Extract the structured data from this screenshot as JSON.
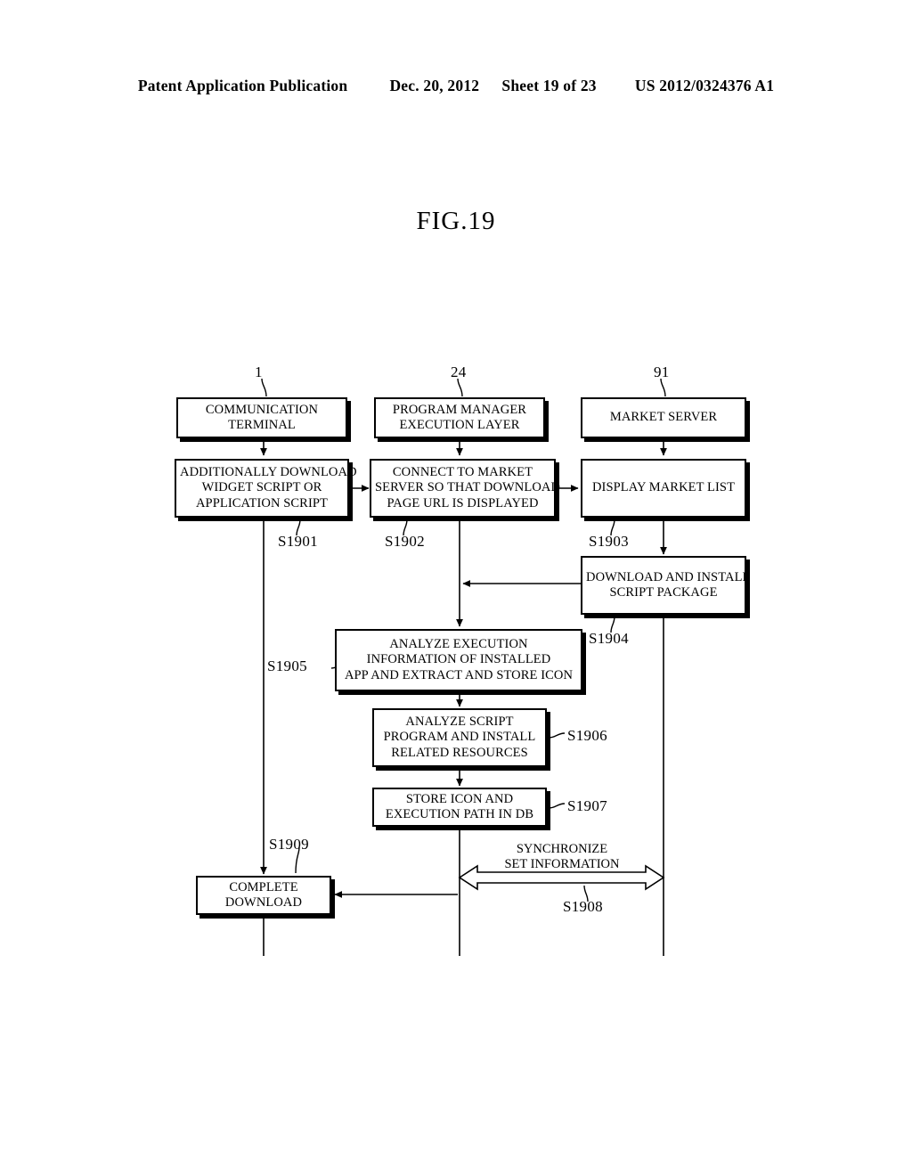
{
  "header": {
    "publication": "Patent Application Publication",
    "date": "Dec. 20, 2012",
    "sheet": "Sheet 19 of 23",
    "patent_number": "US 2012/0324376 A1"
  },
  "figure": {
    "title": "FIG.19"
  },
  "diagram": {
    "type": "sequence-flowchart",
    "lanes": [
      {
        "id": "terminal",
        "ref": "1",
        "title_line1": "COMMUNICATION",
        "title_line2": "TERMINAL"
      },
      {
        "id": "pmlayer",
        "ref": "24",
        "title_line1": "PROGRAM MANAGER",
        "title_line2": "EXECUTION LAYER"
      },
      {
        "id": "market",
        "ref": "91",
        "title_line1": "MARKET SERVER",
        "title_line2": ""
      }
    ],
    "nodes": [
      {
        "id": "lane-terminal",
        "lines": [
          "COMMUNICATION",
          "TERMINAL"
        ]
      },
      {
        "id": "lane-pmlayer",
        "lines": [
          "PROGRAM MANAGER",
          "EXECUTION LAYER"
        ]
      },
      {
        "id": "lane-market",
        "lines": [
          "MARKET SERVER"
        ]
      },
      {
        "id": "s1901-box",
        "lines": [
          "ADDITIONALLY DOWNLOAD",
          "WIDGET SCRIPT OR",
          "APPLICATION SCRIPT"
        ]
      },
      {
        "id": "s1902-box",
        "lines": [
          "CONNECT TO MARKET",
          "SERVER SO THAT DOWNLOAD",
          "PAGE URL IS DISPLAYED"
        ]
      },
      {
        "id": "s1903-box",
        "lines": [
          "DISPLAY MARKET LIST"
        ]
      },
      {
        "id": "s1904-box",
        "lines": [
          "DOWNLOAD AND INSTALL",
          "SCRIPT PACKAGE"
        ]
      },
      {
        "id": "s1905-box",
        "lines": [
          "ANALYZE EXECUTION",
          "INFORMATION OF INSTALLED",
          "APP AND EXTRACT AND STORE ICON"
        ]
      },
      {
        "id": "s1906-box",
        "lines": [
          "ANALYZE SCRIPT",
          "PROGRAM AND INSTALL",
          "RELATED RESOURCES"
        ]
      },
      {
        "id": "s1907-box",
        "lines": [
          "STORE ICON AND",
          "EXECUTION PATH IN DB"
        ]
      },
      {
        "id": "s1909-box",
        "lines": [
          "COMPLETE",
          "DOWNLOAD"
        ]
      }
    ],
    "steps": {
      "s1901": "S1901",
      "s1902": "S1902",
      "s1903": "S1903",
      "s1904": "S1904",
      "s1905": "S1905",
      "s1906": "S1906",
      "s1907": "S1907",
      "s1908": "S1908",
      "s1909": "S1909"
    },
    "sync_arrow": {
      "label_line1": "SYNCHRONIZE",
      "label_line2": "SET INFORMATION",
      "step": "S1908"
    },
    "colors": {
      "stroke": "#000000",
      "fill": "#ffffff",
      "shadow": "#000000"
    }
  }
}
